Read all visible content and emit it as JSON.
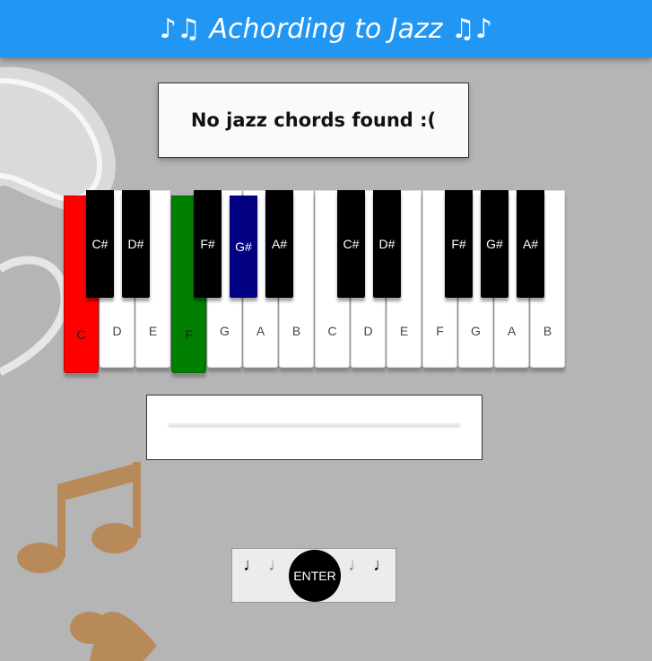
{
  "header": {
    "title": "♪♫ Achording to Jazz ♫♪"
  },
  "result": {
    "message": "No jazz chords found :("
  },
  "piano": {
    "white_keys": [
      {
        "label": "C",
        "state": "red"
      },
      {
        "label": "D",
        "state": ""
      },
      {
        "label": "E",
        "state": ""
      },
      {
        "label": "F",
        "state": "green"
      },
      {
        "label": "G",
        "state": ""
      },
      {
        "label": "A",
        "state": ""
      },
      {
        "label": "B",
        "state": ""
      },
      {
        "label": "C",
        "state": ""
      },
      {
        "label": "D",
        "state": ""
      },
      {
        "label": "E",
        "state": ""
      },
      {
        "label": "F",
        "state": ""
      },
      {
        "label": "G",
        "state": ""
      },
      {
        "label": "A",
        "state": ""
      },
      {
        "label": "B",
        "state": ""
      }
    ],
    "black_keys": [
      {
        "label": "C#",
        "state": ""
      },
      {
        "label": "D#",
        "state": ""
      },
      {
        "label": "F#",
        "state": ""
      },
      {
        "label": "G#",
        "state": "blue"
      },
      {
        "label": "A#",
        "state": ""
      },
      {
        "label": "C#",
        "state": ""
      },
      {
        "label": "D#",
        "state": ""
      },
      {
        "label": "F#",
        "state": ""
      },
      {
        "label": "G#",
        "state": ""
      },
      {
        "label": "A#",
        "state": ""
      }
    ],
    "colors": {
      "red": "#ff0000",
      "green": "#007f00",
      "blue": "#000080"
    }
  },
  "controls": {
    "notes_left": [
      "♩",
      "♩"
    ],
    "notes_right": [
      "♩",
      "♩"
    ],
    "enter_label": "ENTER"
  }
}
